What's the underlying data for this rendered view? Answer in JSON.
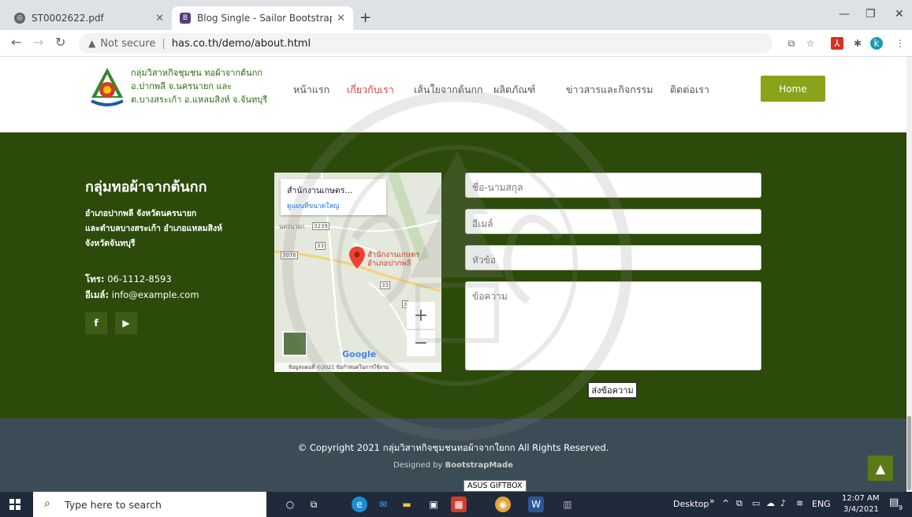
{
  "browser": {
    "tabs": [
      {
        "title": "ST0002622.pdf",
        "active": false
      },
      {
        "title": "Blog Single - Sailor Bootstrap Te",
        "active": true
      }
    ],
    "new_tab": "+",
    "minimize": "—",
    "restore": "❐",
    "close": "✕",
    "address": {
      "security": "Not secure",
      "url": "has.co.th/demo/about.html"
    }
  },
  "header": {
    "brand_lines": [
      "กลุ่มวิสาหกิจชุมชน ทอผ้าจากต้นกก",
      "อ.ปากพลี จ.นครนายก และ",
      "ต.บางสระเก้า อ.แหลมสิงห์ จ.จันทบุรี"
    ],
    "nav": [
      {
        "label": "หน้าแรก",
        "active": false
      },
      {
        "label": "เกี่ยวกับเรา",
        "active": true
      },
      {
        "label": "เส้นใยจากต้นกก",
        "active": false
      },
      {
        "label": "ผลิตภัณฑ์",
        "active": false
      },
      {
        "label": "ข่าวสารและกิจกรรม",
        "active": false
      },
      {
        "label": "ติดต่อเรา",
        "active": false
      }
    ],
    "home_button": "Home"
  },
  "footer": {
    "title": "กลุ่มทอผ้าจากต้นกก",
    "address": [
      "อำเภอปากพลี จังหวัดนครนายก",
      "และตำบลบางสระเก้า อำเภอแหลมสิงห์",
      "จังหวัดจันทบุรี"
    ],
    "phone_label": "โทร:",
    "phone": "06-1112-8593",
    "email_label": "อีเมล์:",
    "email": "info@example.com",
    "social": [
      "f",
      "▶"
    ]
  },
  "map": {
    "card_title": "สำนักงานเกษตร...",
    "card_link": "ดูแผนที่ขนาดใหญ่",
    "pin_label_1": "สำนักงานเกษตร",
    "pin_label_2": "อำเภอปากพลี",
    "zoom_in": "+",
    "zoom_out": "−",
    "google": "Google",
    "attribution": "ข้อมูลแผนที่ ©2021   ข้อกำหนดในการใช้งาน",
    "roads": [
      "3239",
      "33",
      "3076",
      "33",
      "3"
    ],
    "place": "นครนายก"
  },
  "form": {
    "name_placeholder": "ชื่อ-นามสกุล",
    "email_placeholder": "อีเมล์",
    "subject_placeholder": "หัวข้อ",
    "message_placeholder": "ข้อความ",
    "send": "ส่งข้อความ"
  },
  "bottom": {
    "copyright": "© Copyright 2021 กลุ่มวิสาหกิจชุมชนทอผ้าจากใยกก All Rights Reserved.",
    "designed_prefix": "Designed by ",
    "designed_by": "BootstrapMade",
    "back_to_top": "▲"
  },
  "tooltip": "ASUS GIFTBOX",
  "taskbar": {
    "search": "Type here to search",
    "desktop": "Desktop",
    "lang": "ENG",
    "time": "12:07 AM",
    "date": "3/4/2021",
    "notifications": "9"
  },
  "colors": {
    "footer_green": "#2c4a0a",
    "accent_green": "#89a31a",
    "nav_active": "#d9403a",
    "bottom_bar": "#3c4c57"
  }
}
